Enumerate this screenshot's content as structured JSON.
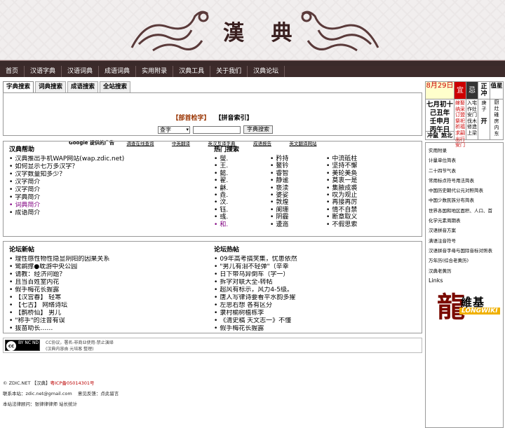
{
  "header": {
    "logo": "漢 典"
  },
  "nav": [
    "首页",
    "汉语字典",
    "汉语词典",
    "成语词典",
    "实用附录",
    "汉典工具",
    "关于我们",
    "汉典论坛"
  ],
  "tabs": [
    "字典搜索",
    "词典搜索",
    "成语搜索",
    "全站搜索"
  ],
  "search": {
    "index1": "【部首检字】",
    "index2": "【拼音索引】",
    "select_value": "查字",
    "button": "字典搜索"
  },
  "ads": {
    "title": "Google 提供的广告",
    "items": [
      "调查在线查询",
      "中英翻译",
      "英汉互译字典",
      "成语报告",
      "英文翻译网站"
    ]
  },
  "help": {
    "title": "汉典帮助",
    "items": [
      "汉典推出手机WAP网站(wap.zdic.net)",
      "如何显示七万多汉字？",
      "汉字数量知多少？",
      "汉字简介",
      "汉字简介",
      "字典简介",
      "词典简介",
      "成语简介"
    ]
  },
  "hot": {
    "title": "热门搜索",
    "col1": [
      "燮.",
      "王.",
      "懿.",
      "翟.",
      "龢.",
      "垚.",
      "汶.",
      "钰.",
      "彧.",
      "和."
    ],
    "col2": [
      "矜持",
      "鳌钤",
      "睿智",
      "静谧",
      "亵渎",
      "婆娑",
      "敦煌",
      "阑珊",
      "阴霾",
      "逶迤"
    ],
    "col3": [
      "中流砥柱",
      "坚持不懈",
      "美轮美奂",
      "莫衷一是",
      "集腋成裘",
      "叹为观止",
      "再接再厉",
      "情不自禁",
      "断章取义",
      "不假思索"
    ]
  },
  "forum_new": {
    "title": "论坛新帖",
    "items": [
      "理性感性物性隐显阴阳的因果关系",
      "鹭鹚撑●耽游中央公园",
      "请教：经济问题？",
      "且当百姓室内花",
      "假手梅花长握露",
      "【汉宫春】 轻寒",
      "【七古】 网络诗坛",
      "【鹊桥仙】 男儿",
      "\"称手\"的注音有误",
      "拔苗助长……"
    ]
  },
  "forum_hot": {
    "title": "论坛热帖",
    "items": [
      "09年高考搞笑集，忧患依然",
      "\"男儿有泪不轻弹\"（辛幸",
      "日下带乌异倒车（字一）",
      "拆字对联大全-转帖",
      "超风有标示，风力4-5级。",
      "唐人写律诗要看平水韵多擢",
      "左思右想 各有区分",
      "隶村榆树植栋李",
      "《清史稿 天文志一》不懂",
      "假手梅花长握露"
    ]
  },
  "cc": {
    "badge_c": "cc",
    "badge_t": "BY NC ND",
    "line1": "CC协议，署名-非商业使用-禁止演绎",
    "line2": "(汉典内容由 元培客 整理)"
  },
  "footer": {
    "line1a": "© ZDIC.NET 【汉典】",
    "line1b": "粤ICP备05014301号",
    "line2a": "联系本站：zdic.net@gmail.com",
    "line2b": "意见反馈：点此留言",
    "line3": "本站法律顾问：张律律律师 站长统计"
  },
  "calendar": {
    "date": "8月29日",
    "lunar": [
      "七月初十",
      "己丑年",
      "壬申月",
      "丙午日"
    ],
    "jie1": "冲鼠",
    "jie2": "煞北",
    "yi": "宜",
    "ji": "忌",
    "yi_text": [
      "嫁娶",
      "纳采",
      "订盟",
      "祭祀",
      "祈福",
      "求嗣",
      "出行",
      "安门"
    ],
    "ji_text": [
      "入宅",
      "作灶",
      "安门",
      "伐木",
      "修造",
      "上梁"
    ],
    "gan1": "正冲",
    "gan2": "值星",
    "gan_text1": [
      "庚",
      "子"
    ],
    "gan_text2": [
      "开"
    ],
    "extra": [
      "厨",
      "灶",
      "碓",
      "房",
      "内",
      "东"
    ]
  },
  "links": {
    "items": [
      "实用附录",
      "计量单位简表",
      "二十四节气表",
      "常用标点符号用法简表",
      "中国历史朝代公元对照简表",
      "中国少数民族分布简表",
      "世界各国和地区面积、人口、首",
      "化学元素周期表",
      "汉语拼音方案",
      "满语注音符号",
      "汉语拼音字母与国际音标对照表",
      "万年历(综合老黄历)",
      "汉典老黄历"
    ],
    "title": "Links"
  },
  "longwiki": {
    "char": "龍",
    "name": "維基",
    "en": "LONGWIKI"
  }
}
